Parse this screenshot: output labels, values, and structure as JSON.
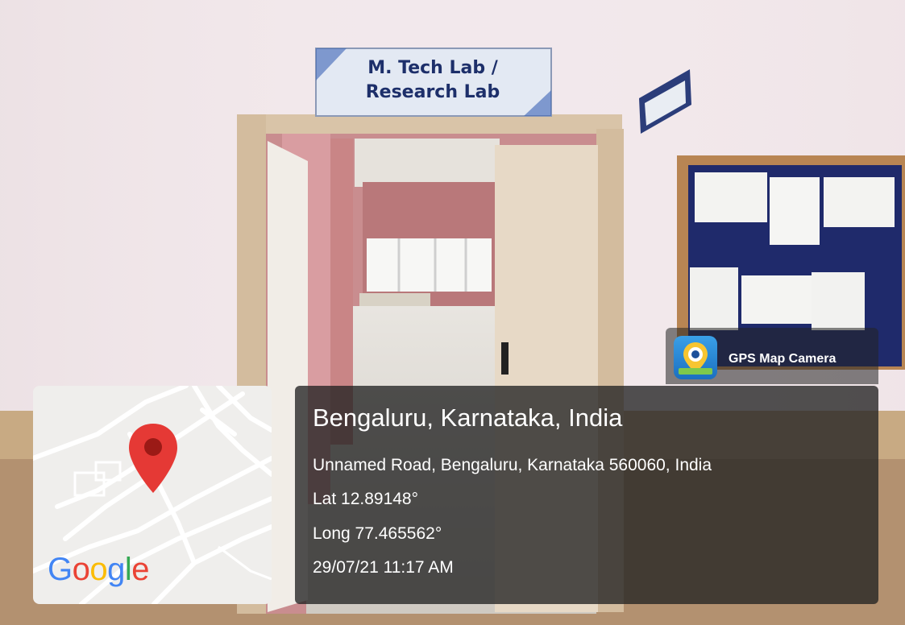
{
  "scene": {
    "sign_text": "M. Tech Lab / Research Lab",
    "colors": {
      "wall": "#f1e6ea",
      "door_frame": "#d9c4a8",
      "notice_board": "#1f2a6b"
    }
  },
  "gps_badge": {
    "label": "GPS Map Camera",
    "icon": "gps-camera-app-icon"
  },
  "map": {
    "logo_text": "Google",
    "marker_icon": "location-pin-icon"
  },
  "location": {
    "title": "Bengaluru, Karnataka, India",
    "address": "Unnamed Road, Bengaluru, Karnataka 560060, India",
    "lat": "Lat 12.89148°",
    "long": "Long 77.465562°",
    "datetime": "29/07/21 11:17 AM"
  }
}
